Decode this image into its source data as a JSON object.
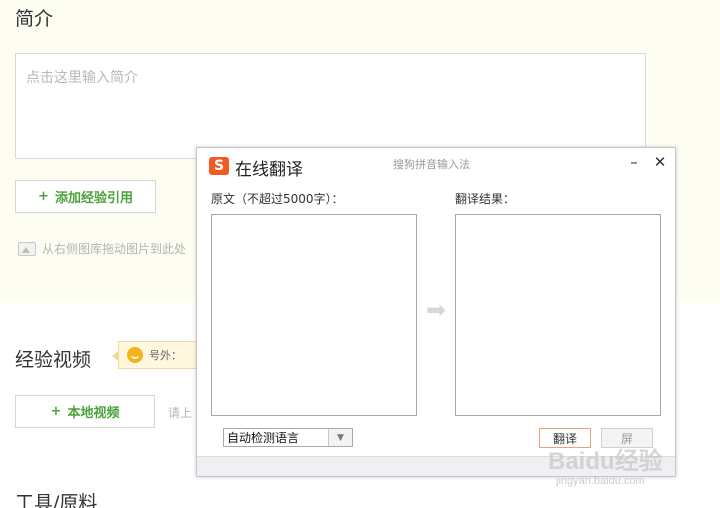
{
  "page": {
    "intro_title": "简介",
    "intro_placeholder": "点击这里输入简介",
    "add_reference_label": "添加经验引用",
    "drag_hint": "从右侧图库拖动图片到此处",
    "video_title": "经验视频",
    "bubble_text": "号外：",
    "local_video_label": "本地视频",
    "upload_hint_partial": "请上",
    "tools_title": "工具/原料"
  },
  "dialog": {
    "title": "在线翻译",
    "brand": "搜狗拼音输入法",
    "minimize": "–",
    "close": "✕",
    "source_label": "原文（不超过5000字）：",
    "result_label": "翻译结果：",
    "language_selected": "自动检测语言",
    "translate_button": "翻译",
    "screen_button": "屏"
  },
  "icons": {
    "plus": "+",
    "logo_letter": "S",
    "arrow": "➡",
    "caret": "▼"
  },
  "watermark": {
    "brand": "Baidu经验",
    "url": "jingyan.baidu.com"
  },
  "colors": {
    "accent_green": "#4aa33a",
    "logo_orange": "#f15a22",
    "panel_bg": "#fdfdf1"
  }
}
